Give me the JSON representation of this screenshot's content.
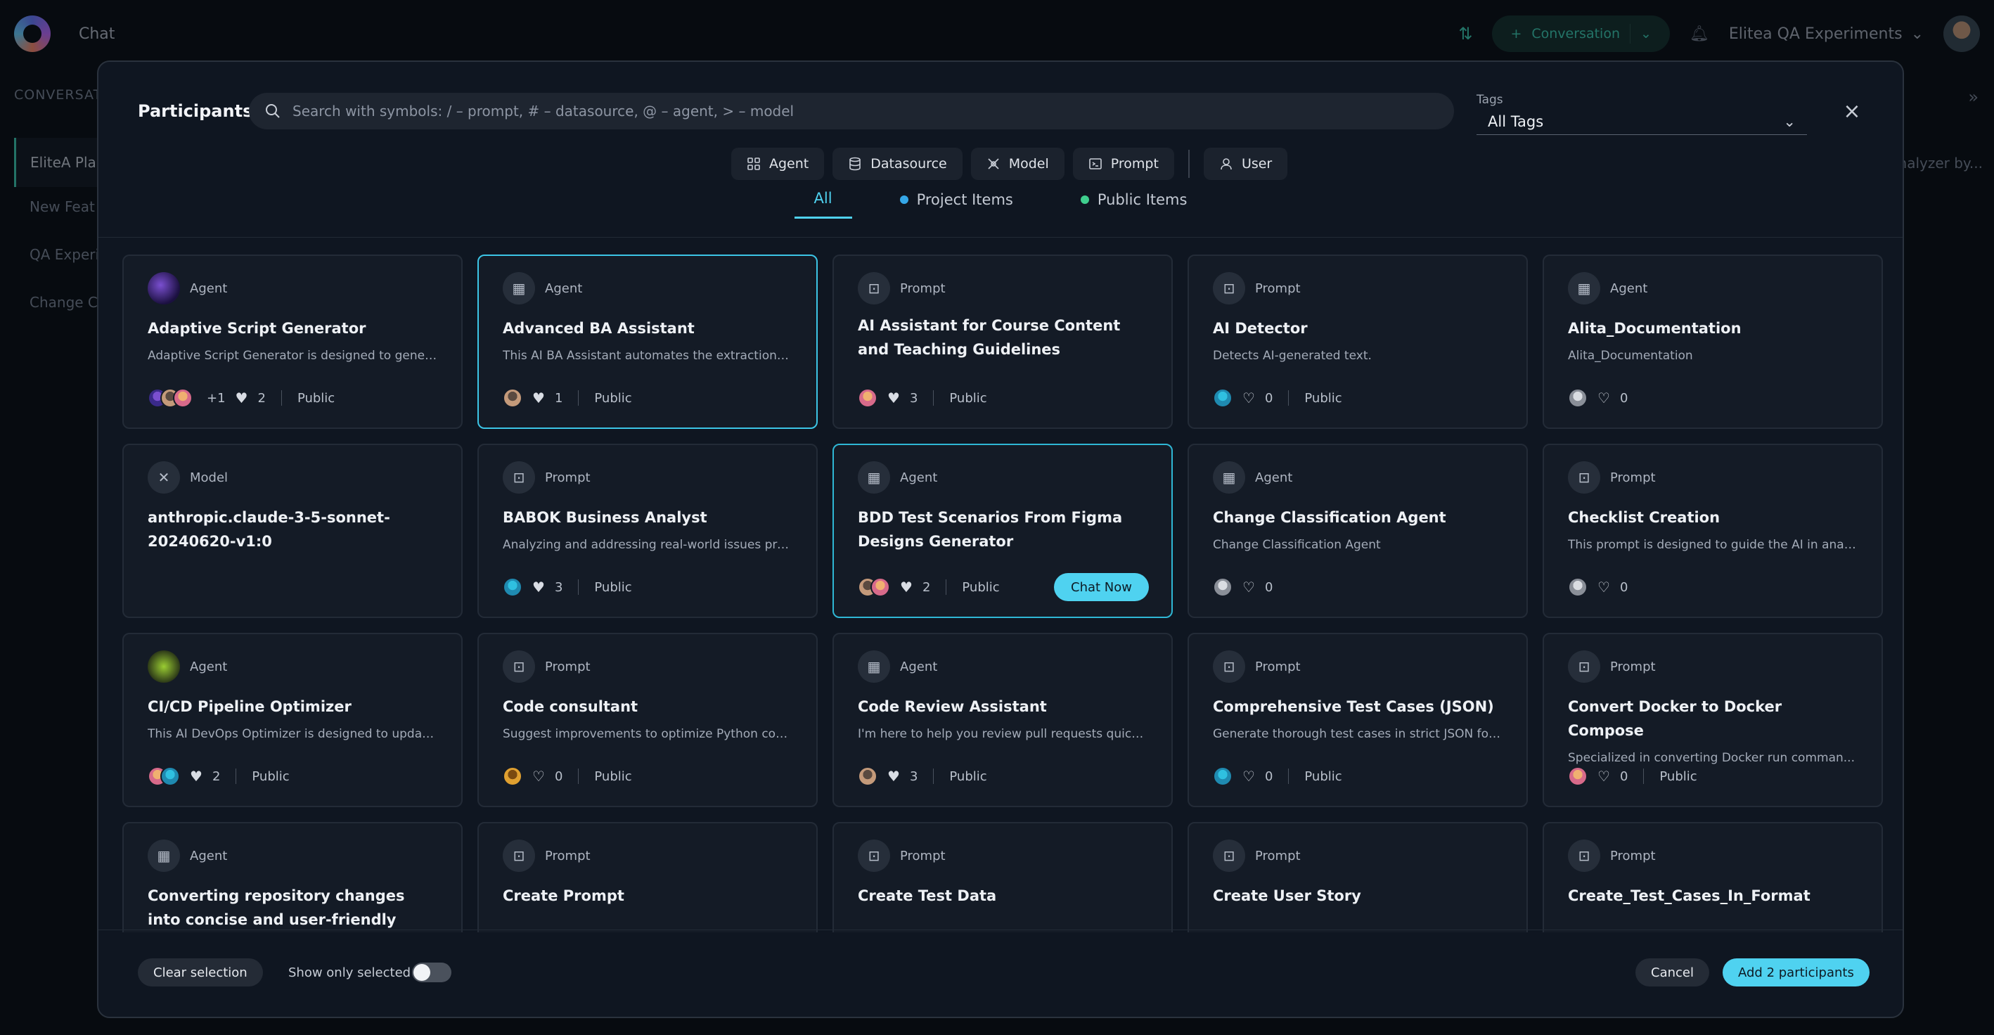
{
  "header": {
    "app_title": "Chat",
    "conversation_label": "Conversation",
    "project_name": "Elitea QA Experiments"
  },
  "sidebar": {
    "section_label": "CONVERSAT",
    "items": [
      "EliteA Pla",
      "New Feat",
      "QA Experi",
      "Change C"
    ]
  },
  "right_peek": {
    "text": "nalyzer by..."
  },
  "modal": {
    "title": "Participants",
    "search_placeholder": "Search with symbols: / – prompt, # – datasource, @ – agent, > – model",
    "tags_label": "Tags",
    "tags_value": "All Tags",
    "filters": [
      {
        "label": "Agent",
        "icon": "grid-icon"
      },
      {
        "label": "Datasource",
        "icon": "database-icon"
      },
      {
        "label": "Model",
        "icon": "model-icon"
      },
      {
        "label": "Prompt",
        "icon": "terminal-icon"
      },
      {
        "label": "User",
        "icon": "user-icon"
      }
    ],
    "tabs": [
      {
        "label": "All",
        "active": true
      },
      {
        "label": "Project Items",
        "dot_color": "#35a7e8"
      },
      {
        "label": "Public Items",
        "dot_color": "#3fcf8e"
      }
    ],
    "footer": {
      "clear_label": "Clear selection",
      "show_only_label": "Show only selected",
      "cancel_label": "Cancel",
      "add_label": "Add 2 participants"
    },
    "chat_now_label": "Chat Now"
  },
  "cards": [
    {
      "type": "Agent",
      "name": "Adaptive Script Generator",
      "desc": "Adaptive Script Generator is designed to gener...",
      "extra": "+1",
      "likes": "2",
      "liked": true,
      "public": "Public"
    },
    {
      "type": "Agent",
      "name": "Advanced BA Assistant",
      "desc": "This AI BA Assistant automates the extraction o...",
      "extra": "",
      "likes": "1",
      "liked": true,
      "public": "Public"
    },
    {
      "type": "Prompt",
      "name": "AI Assistant for Course Content and Teaching Guidelines",
      "desc": "",
      "extra": "",
      "likes": "3",
      "liked": true,
      "public": "Public"
    },
    {
      "type": "Prompt",
      "name": "AI Detector",
      "desc": "Detects AI-generated text.",
      "extra": "",
      "likes": "0",
      "liked": false,
      "public": "Public"
    },
    {
      "type": "Agent",
      "name": "Alita_Documentation",
      "desc": "Alita_Documentation",
      "extra": "",
      "likes": "0",
      "liked": false,
      "public": ""
    },
    {
      "type": "Model",
      "name": "anthropic.claude-3-5-sonnet-20240620-v1:0",
      "desc": "",
      "extra": "",
      "likes": "",
      "liked": false,
      "public": ""
    },
    {
      "type": "Prompt",
      "name": "BABOK Business Analyst",
      "desc": "Analyzing and addressing real-world issues pre...",
      "extra": "",
      "likes": "3",
      "liked": true,
      "public": "Public"
    },
    {
      "type": "Agent",
      "name": "BDD Test Scenarios From Figma Designs Generator",
      "desc": "",
      "extra": "",
      "likes": "2",
      "liked": true,
      "public": "Public"
    },
    {
      "type": "Agent",
      "name": "Change Classification Agent",
      "desc": "Change Classification Agent",
      "extra": "",
      "likes": "0",
      "liked": false,
      "public": ""
    },
    {
      "type": "Prompt",
      "name": "Checklist Creation",
      "desc": "This prompt is designed to guide the AI in analy...",
      "extra": "",
      "likes": "0",
      "liked": false,
      "public": ""
    },
    {
      "type": "Agent",
      "name": "CI/CD Pipeline Optimizer",
      "desc": "This AI DevOps Optimizer is designed to updat...",
      "extra": "",
      "likes": "2",
      "liked": true,
      "public": "Public"
    },
    {
      "type": "Prompt",
      "name": "Code consultant",
      "desc": "Suggest improvements to optimize Python cod...",
      "extra": "",
      "likes": "0",
      "liked": false,
      "public": "Public"
    },
    {
      "type": "Agent",
      "name": "Code Review Assistant",
      "desc": "I'm here to help you review pull requests quickl...",
      "extra": "",
      "likes": "3",
      "liked": true,
      "public": "Public"
    },
    {
      "type": "Prompt",
      "name": "Comprehensive Test Cases (JSON)",
      "desc": "Generate thorough test cases in strict JSON for...",
      "extra": "",
      "likes": "0",
      "liked": false,
      "public": "Public"
    },
    {
      "type": "Prompt",
      "name": "Convert Docker to Docker Compose",
      "desc": "Specialized in converting Docker run comman...",
      "extra": "",
      "likes": "0",
      "liked": false,
      "public": "Public"
    },
    {
      "type": "Agent",
      "name": "Converting repository changes into concise and user-friendly testing ...",
      "desc": "",
      "extra": "",
      "likes": "",
      "liked": false,
      "public": ""
    },
    {
      "type": "Prompt",
      "name": "Create Prompt",
      "desc": "",
      "extra": "",
      "likes": "",
      "liked": false,
      "public": ""
    },
    {
      "type": "Prompt",
      "name": "Create Test Data",
      "desc": "",
      "extra": "",
      "likes": "",
      "liked": false,
      "public": ""
    },
    {
      "type": "Prompt",
      "name": "Create User Story",
      "desc": "",
      "extra": "",
      "likes": "",
      "liked": false,
      "public": ""
    },
    {
      "type": "Prompt",
      "name": "Create_Test_Cases_In_Format",
      "desc": "",
      "extra": "",
      "likes": "",
      "liked": false,
      "public": ""
    }
  ]
}
